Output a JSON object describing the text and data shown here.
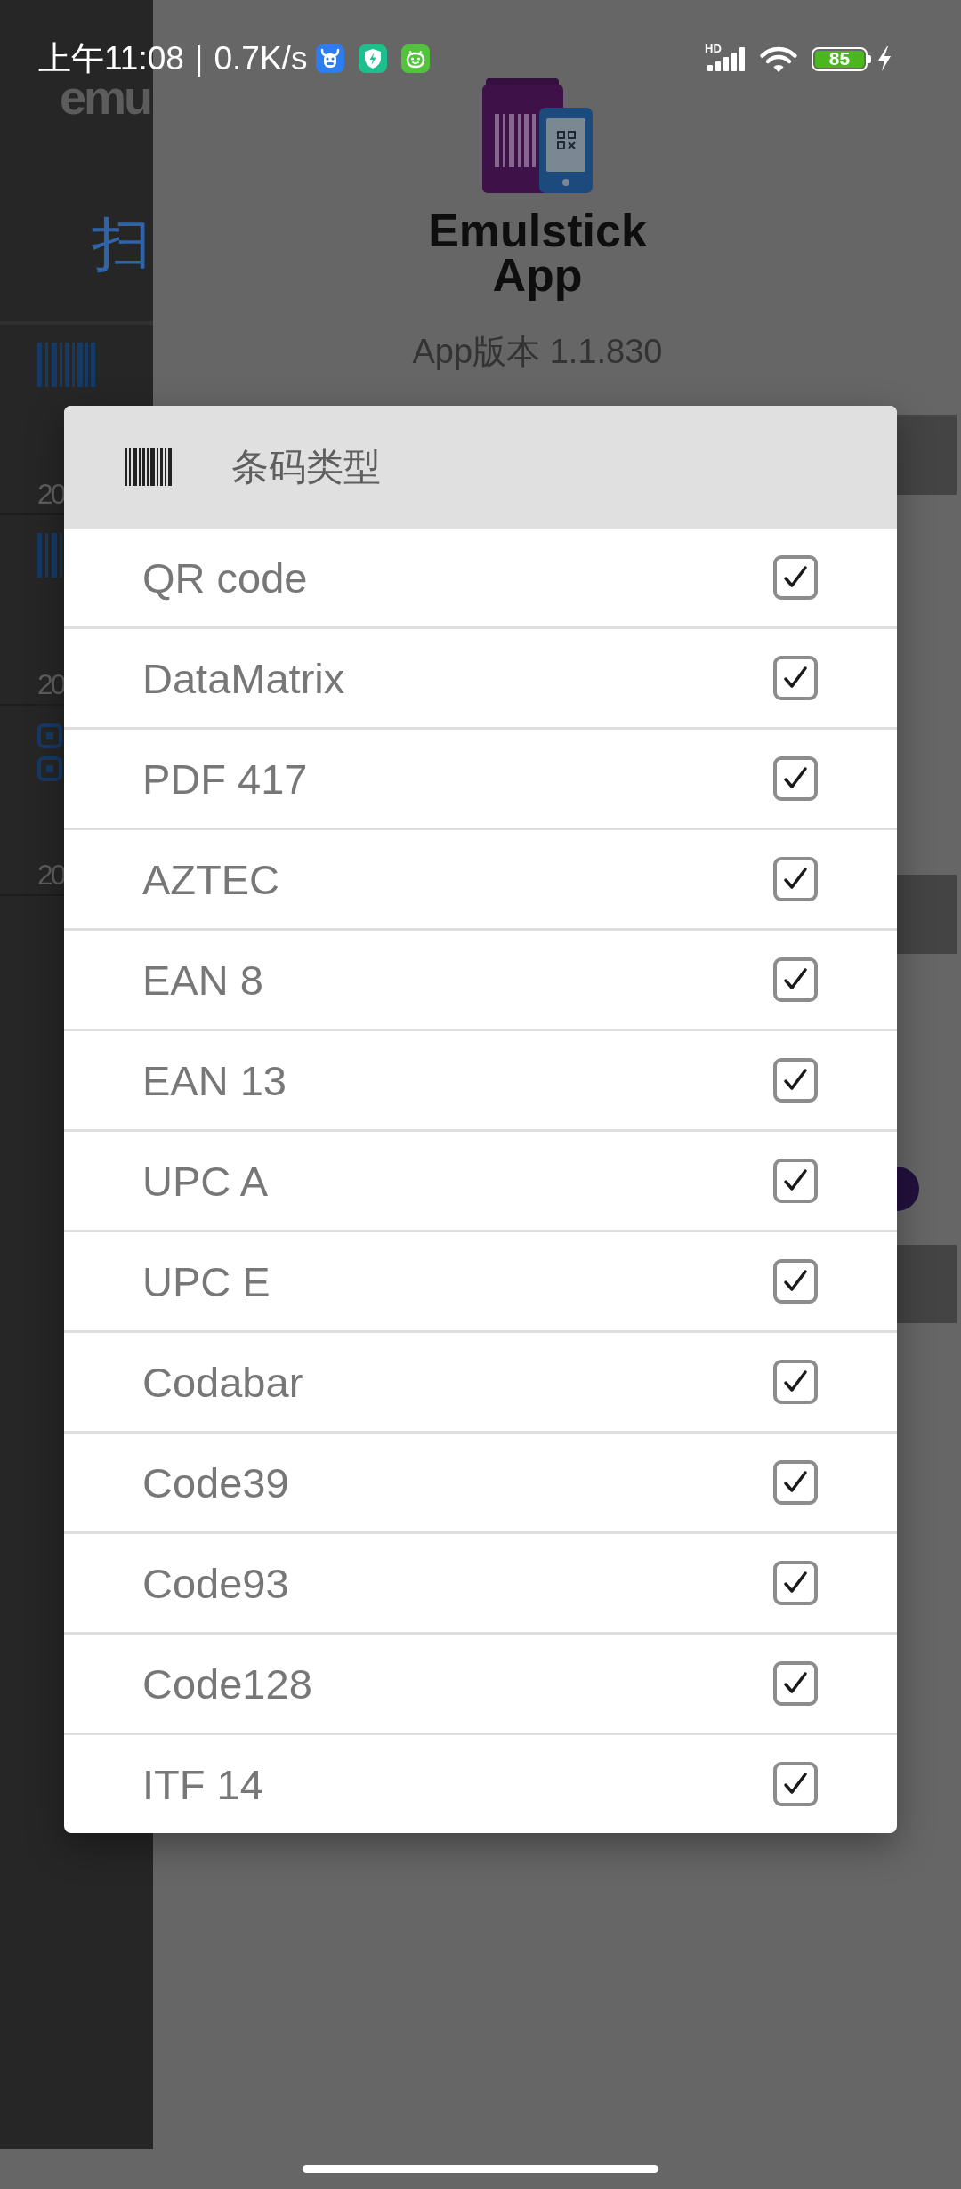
{
  "status_bar": {
    "time": "上午11:08",
    "separator": "|",
    "net_speed": "0.7K/s",
    "network_label": "HD",
    "battery": "85"
  },
  "main_screen": {
    "title": "emu",
    "tab": "扫",
    "records": [
      {
        "kind": "barcode",
        "date": "20"
      },
      {
        "kind": "barcode",
        "date": "20"
      },
      {
        "kind": "qr",
        "date": "20"
      }
    ]
  },
  "drawer": {
    "logo_text": "Emulstick App",
    "version": "App版本 1.1.830"
  },
  "dialog": {
    "title": "条码类型",
    "items": [
      {
        "label": "QR code",
        "checked": true
      },
      {
        "label": "DataMatrix",
        "checked": true
      },
      {
        "label": "PDF 417",
        "checked": true
      },
      {
        "label": "AZTEC",
        "checked": true
      },
      {
        "label": "EAN 8",
        "checked": true
      },
      {
        "label": "EAN 13",
        "checked": true
      },
      {
        "label": "UPC A",
        "checked": true
      },
      {
        "label": "UPC E",
        "checked": true
      },
      {
        "label": "Codabar",
        "checked": true
      },
      {
        "label": "Code39",
        "checked": true
      },
      {
        "label": "Code93",
        "checked": true
      },
      {
        "label": "Code128",
        "checked": true
      },
      {
        "label": "ITF 14",
        "checked": true
      }
    ]
  }
}
